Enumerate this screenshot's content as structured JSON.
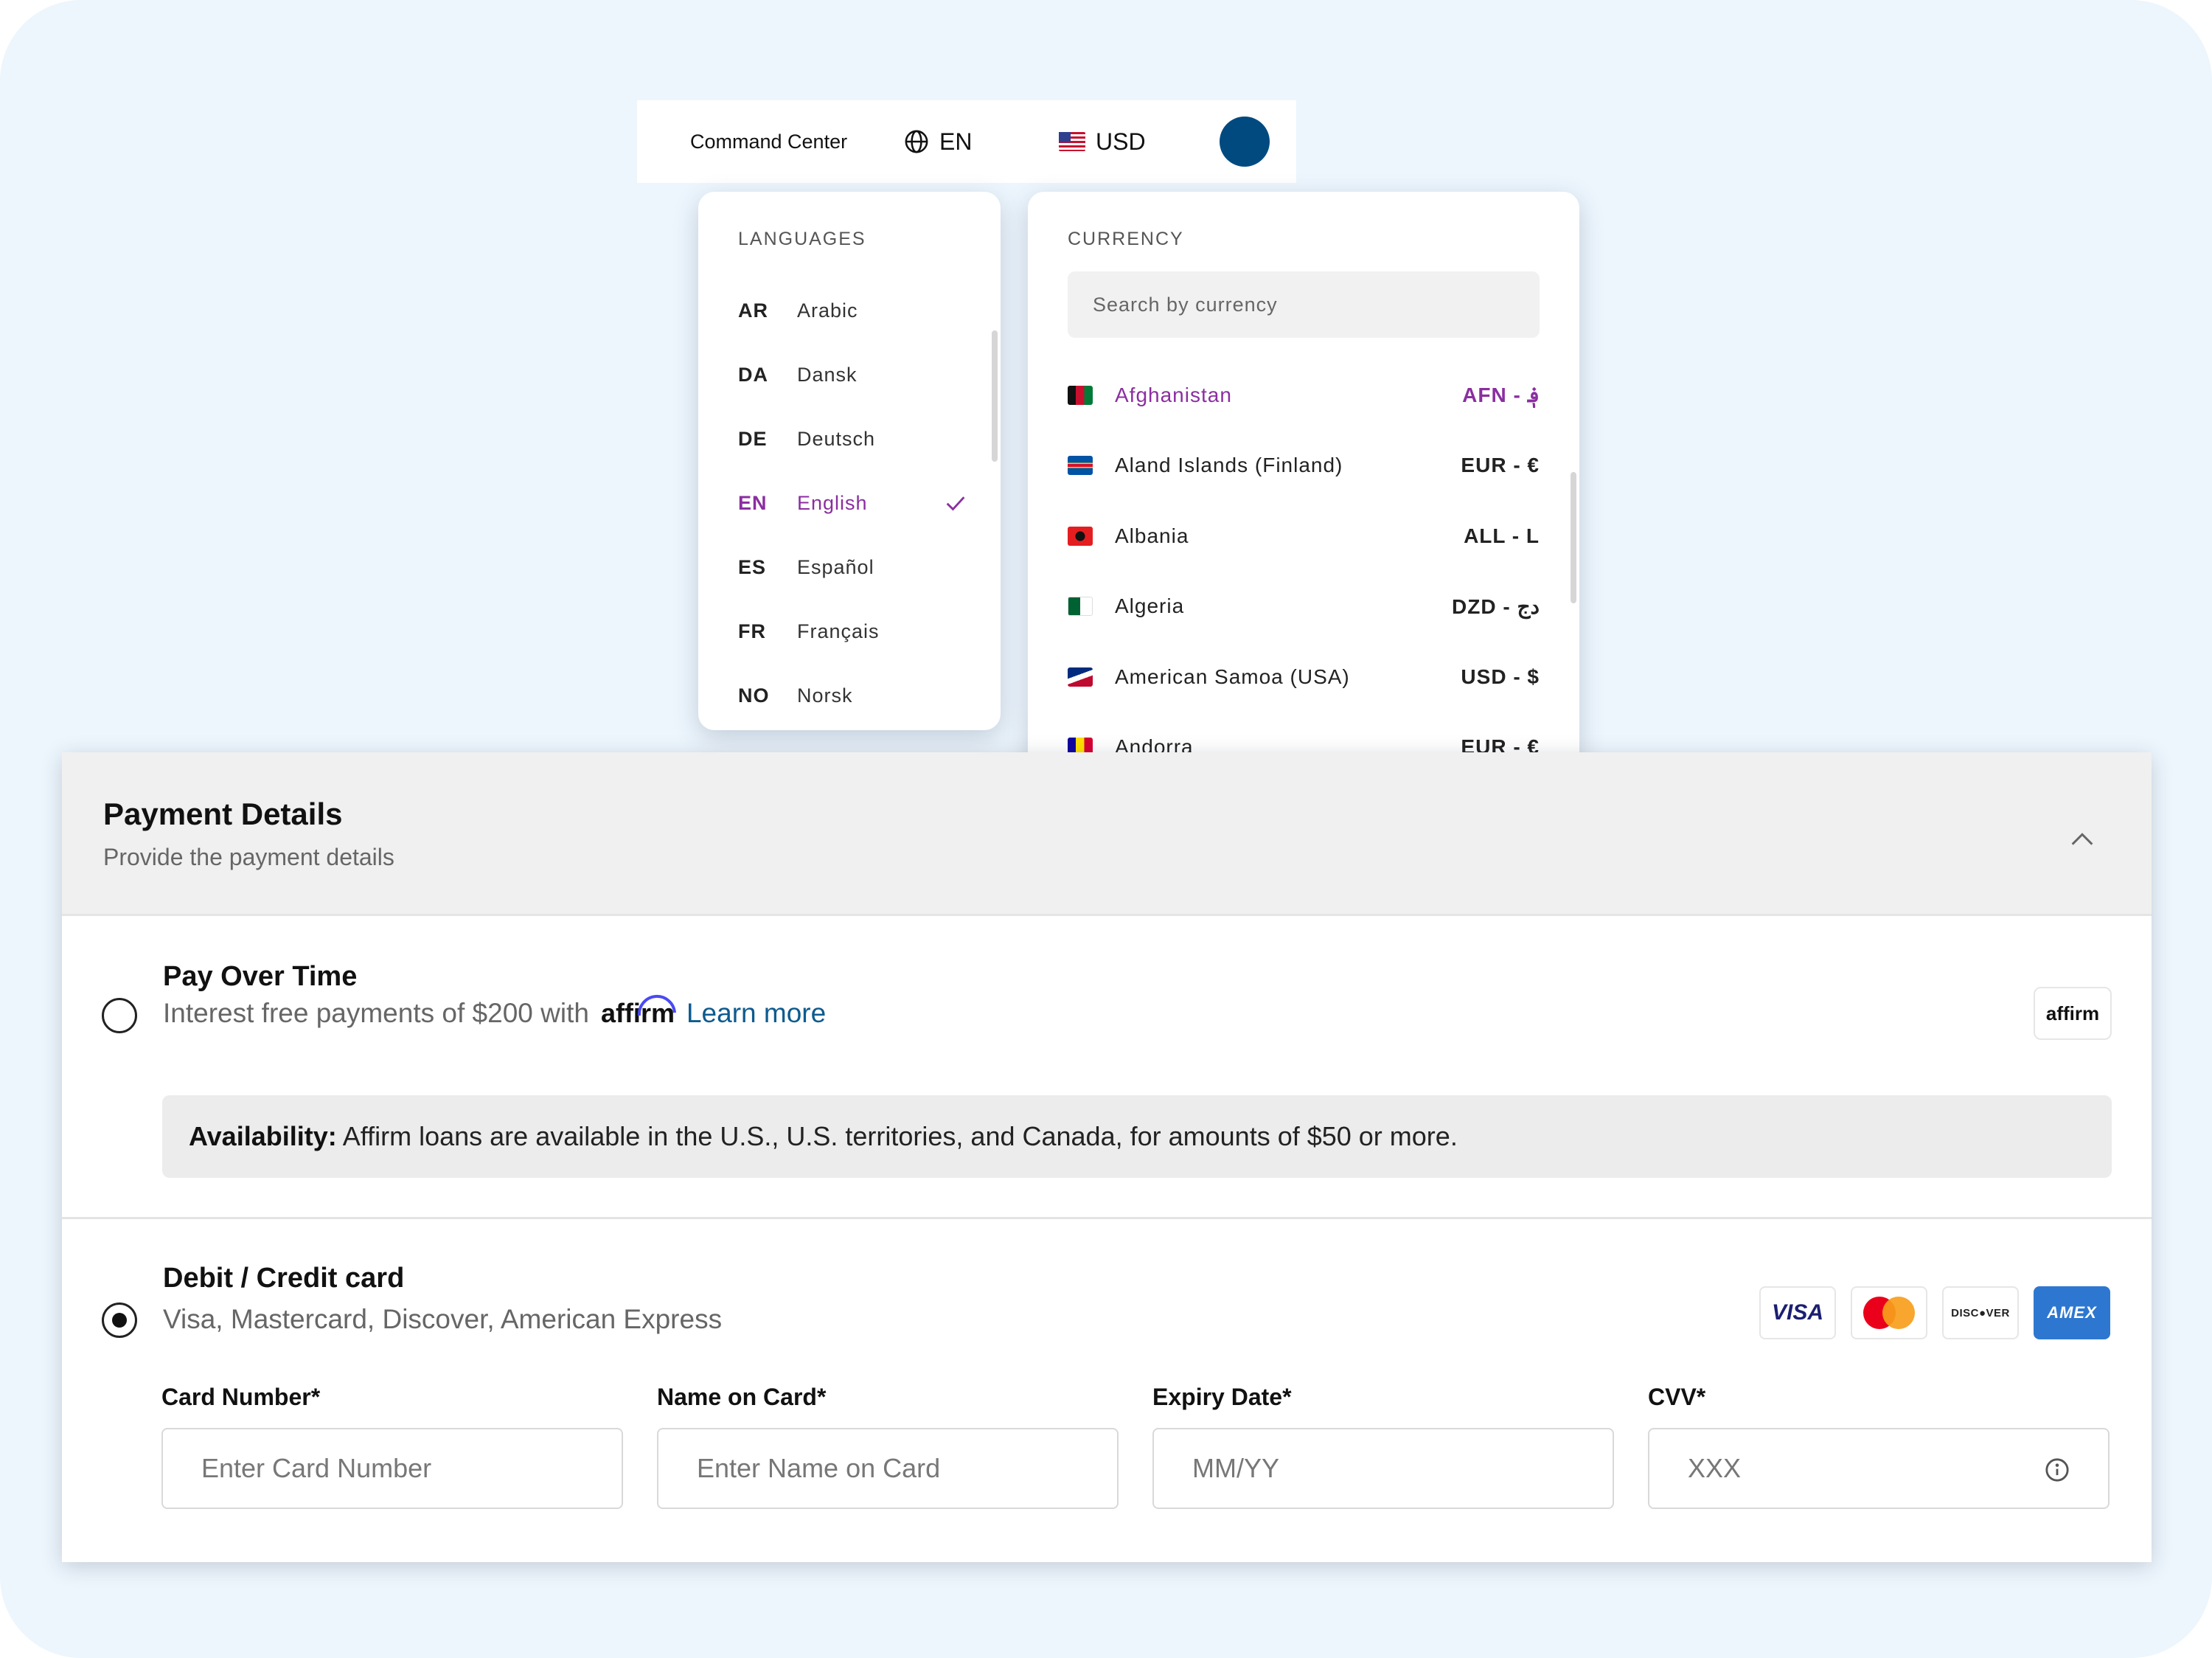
{
  "topbar": {
    "command_center": "Command Center",
    "language_code": "EN",
    "currency_code": "USD"
  },
  "languages": {
    "title": "LANGUAGES",
    "items": [
      {
        "code": "AR",
        "name": "Arabic"
      },
      {
        "code": "DA",
        "name": "Dansk"
      },
      {
        "code": "DE",
        "name": "Deutsch"
      },
      {
        "code": "EN",
        "name": "English"
      },
      {
        "code": "ES",
        "name": "Español"
      },
      {
        "code": "FR",
        "name": "Français"
      },
      {
        "code": "NO",
        "name": "Norsk"
      }
    ],
    "selected": "EN"
  },
  "currency": {
    "title": "CURRENCY",
    "search_placeholder": "Search by currency",
    "items": [
      {
        "country": "Afghanistan",
        "code": "AFN - ؋"
      },
      {
        "country": "Aland Islands (Finland)",
        "code": "EUR - €"
      },
      {
        "country": "Albania",
        "code": "ALL - L"
      },
      {
        "country": "Algeria",
        "code": "DZD - دج"
      },
      {
        "country": "American Samoa (USA)",
        "code": "USD - $"
      },
      {
        "country": "Andorra",
        "code": "EUR - €"
      }
    ],
    "selected": "Afghanistan"
  },
  "payment": {
    "title": "Payment Details",
    "subtitle": "Provide the payment details",
    "pay_over_time": {
      "title": "Pay Over Time",
      "desc": "Interest free payments of $200 with",
      "brand": "affirm",
      "learn_more": "Learn more",
      "badge": "affirm",
      "availability_label": "Availability:",
      "availability_text": " Affirm loans are available in the U.S., U.S. territories, and Canada, for amounts of $50 or more."
    },
    "card": {
      "title": "Debit / Credit card",
      "desc": "Visa, Mastercard, Discover, American Express",
      "brands": {
        "visa": "VISA",
        "discover": "DISC●VER",
        "amex": "AMEX"
      },
      "fields": {
        "card_number": {
          "label": "Card Number*",
          "placeholder": "Enter Card Number"
        },
        "name_on_card": {
          "label": "Name on Card*",
          "placeholder": "Enter Name on Card"
        },
        "expiry": {
          "label": "Expiry Date*",
          "placeholder": "MM/YY"
        },
        "cvv": {
          "label": "CVV*",
          "placeholder": "XXX"
        }
      }
    }
  },
  "colors": {
    "accent_purple": "#8b2ea0",
    "link_blue": "#0d5b8f",
    "avatar": "#004a7f",
    "page_bg": "#edf6fd"
  }
}
